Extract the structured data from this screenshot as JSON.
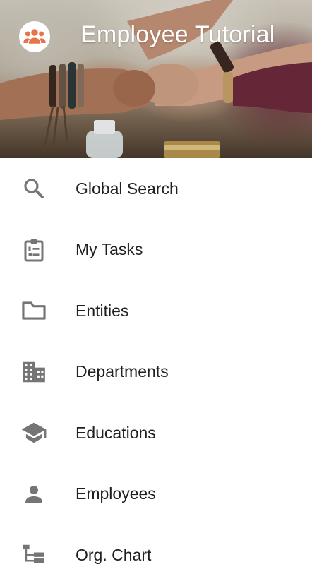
{
  "app": {
    "title": "Employee Tutorial"
  },
  "header": {
    "avatar_icon": "group-icon",
    "accent_color": "#e8734a"
  },
  "menu": {
    "items": [
      {
        "label": "Global Search",
        "icon": "search-icon"
      },
      {
        "label": "My Tasks",
        "icon": "clipboard-list-icon"
      },
      {
        "label": "Entities",
        "icon": "folder-icon"
      },
      {
        "label": "Departments",
        "icon": "building-icon"
      },
      {
        "label": "Educations",
        "icon": "graduation-cap-icon"
      },
      {
        "label": "Employees",
        "icon": "person-icon"
      },
      {
        "label": "Org. Chart",
        "icon": "org-chart-icon"
      }
    ],
    "icon_color": "#757575",
    "text_color": "#202020"
  }
}
